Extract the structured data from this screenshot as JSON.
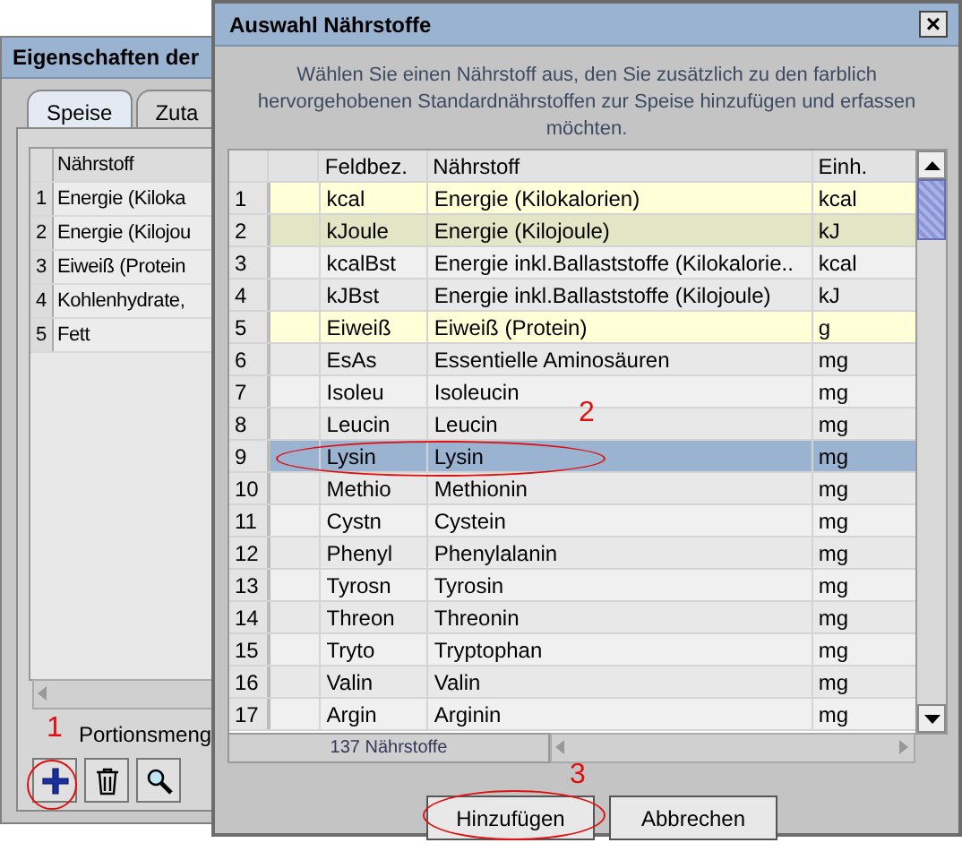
{
  "back_window": {
    "title": "Eigenschaften der",
    "tabs": [
      {
        "label": "Speise",
        "selected": true
      },
      {
        "label": "Zuta",
        "selected": false
      }
    ],
    "table": {
      "columns": [
        "Nährstoff"
      ],
      "rows": [
        {
          "index": "1",
          "name": "Energie (Kiloka"
        },
        {
          "index": "2",
          "name": "Energie (Kilojou"
        },
        {
          "index": "3",
          "name": "Eiweiß (Protein"
        },
        {
          "index": "4",
          "name": "Kohlenhydrate,"
        },
        {
          "index": "5",
          "name": "Fett"
        }
      ]
    },
    "portion_label": "Portionsmeng",
    "tools": [
      {
        "kind": "add"
      },
      {
        "kind": "delete"
      },
      {
        "kind": "search"
      }
    ]
  },
  "dialog": {
    "title": "Auswahl Nährstoffe",
    "close": "×",
    "intro": "Wählen Sie einen Nährstoff aus, den Sie zusätzlich zu den farblich hervorgehobenen Standardnährstoffen zur Speise hinzufügen und erfassen möchten.",
    "table": {
      "columns": [
        "Feldbez.",
        "Nährstoff",
        "Einh."
      ],
      "rows": [
        {
          "index": "1",
          "code": "kcal",
          "name": "Energie (Kilokalorien)",
          "unit": "kcal",
          "color": "#ffffd8",
          "selected": false
        },
        {
          "index": "2",
          "code": "kJoule",
          "name": "Energie (Kilojoule)",
          "unit": "kJ",
          "color": "#e3e6c4",
          "selected": false
        },
        {
          "index": "3",
          "code": "kcalBst",
          "name": "Energie inkl.Ballaststoffe (Kilokalorie..",
          "unit": "kcal",
          "selected": false
        },
        {
          "index": "4",
          "code": "kJBst",
          "name": "Energie inkl.Ballaststoffe (Kilojoule)",
          "unit": "kJ",
          "selected": false
        },
        {
          "index": "5",
          "code": "Eiweiß",
          "name": "Eiweiß (Protein)",
          "unit": "g",
          "color": "#ffffd8",
          "selected": false
        },
        {
          "index": "6",
          "code": "EsAs",
          "name": "Essentielle Aminosäuren",
          "unit": "mg",
          "selected": false
        },
        {
          "index": "7",
          "code": "Isoleu",
          "name": "Isoleucin",
          "unit": "mg",
          "selected": false
        },
        {
          "index": "8",
          "code": "Leucin",
          "name": "Leucin",
          "unit": "mg",
          "selected": false
        },
        {
          "index": "9",
          "code": "Lysin",
          "name": "Lysin",
          "unit": "mg",
          "selected": true
        },
        {
          "index": "10",
          "code": "Methio",
          "name": "Methionin",
          "unit": "mg",
          "selected": false
        },
        {
          "index": "11",
          "code": "Cystn",
          "name": "Cystein",
          "unit": "mg",
          "selected": false
        },
        {
          "index": "12",
          "code": "Phenyl",
          "name": "Phenylalanin",
          "unit": "mg",
          "selected": false
        },
        {
          "index": "13",
          "code": "Tyrosn",
          "name": "Tyrosin",
          "unit": "mg",
          "selected": false
        },
        {
          "index": "14",
          "code": "Threon",
          "name": "Threonin",
          "unit": "mg",
          "selected": false
        },
        {
          "index": "15",
          "code": "Tryto",
          "name": "Tryptophan",
          "unit": "mg",
          "selected": false
        },
        {
          "index": "16",
          "code": "Valin",
          "name": "Valin",
          "unit": "mg",
          "selected": false
        },
        {
          "index": "17",
          "code": "Argin",
          "name": "Arginin",
          "unit": "mg",
          "selected": false
        }
      ]
    },
    "count": "137 Nährstoffe",
    "buttons": [
      "Hinzufügen",
      "Abbrechen"
    ]
  },
  "annotations": [
    {
      "label": "1",
      "kind": "add"
    },
    {
      "label": "2",
      "kind": "row"
    },
    {
      "label": "3",
      "kind": "button"
    }
  ]
}
